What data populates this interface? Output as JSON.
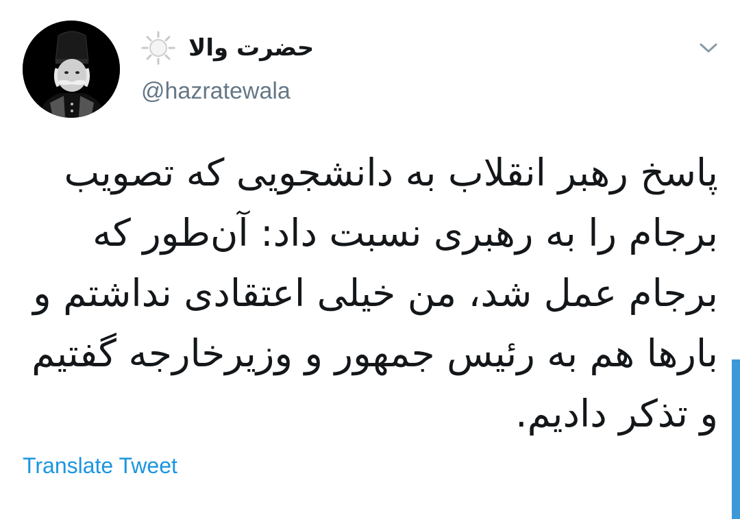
{
  "tweet": {
    "display_name": "حضرت والا",
    "handle": "@hazratewala",
    "text": "پاسخ رهبر انقلاب به دانشجویی که تصویب برجام را به رهبری نسبت داد: آن‌طور که برجام عمل شد، من خیلی اعتقادی نداشتم و بارها هم به رئیس جمهور و وزیرخارجه گفتیم و تذکر دادیم.",
    "translate_label": "Translate Tweet",
    "icons": {
      "avatar": "avatar-portrait",
      "name_badge": "sun-icon",
      "menu": "chevron-down-icon"
    }
  },
  "colors": {
    "text": "#14171a",
    "handle": "#657786",
    "link": "#1b95e0",
    "scrollbar": "#3d98d8"
  }
}
